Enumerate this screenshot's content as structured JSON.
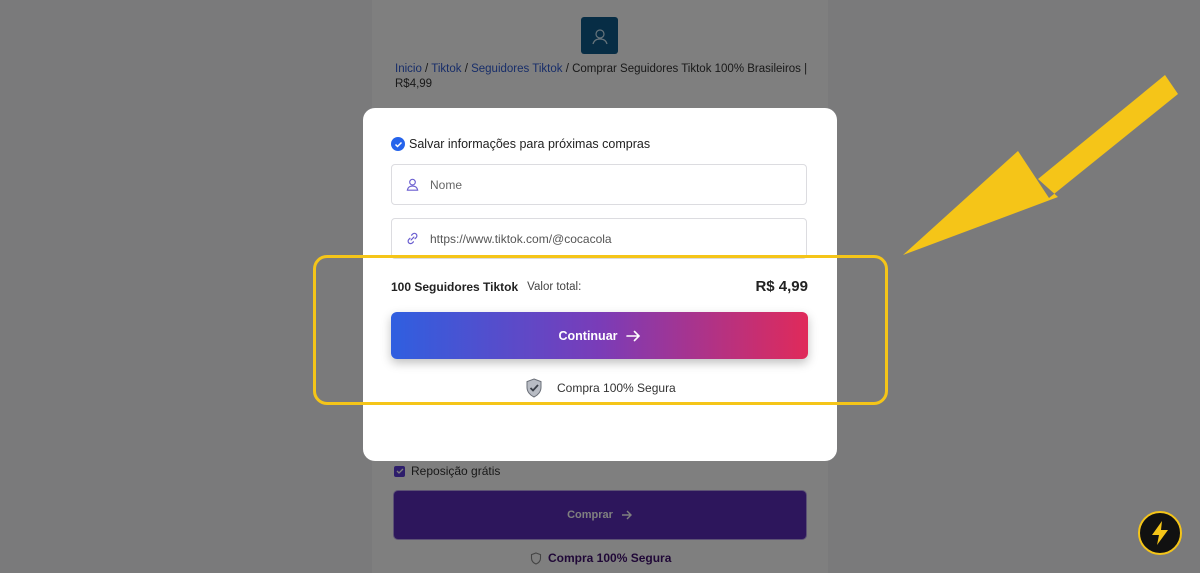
{
  "background": {
    "breadcrumb": {
      "home": "Inicio",
      "sep": " / ",
      "tiktok": "Tiktok",
      "followers": "Seguidores Tiktok",
      "current": "Comprar Seguidores Tiktok 100% Brasileiros | R$4,99"
    },
    "reposicao": "Reposição grátis",
    "buy_label": "Comprar",
    "secure_label": "Compra 100% Segura"
  },
  "modal": {
    "save_label": "Salvar informações para próximas compras",
    "name_placeholder": "Nome",
    "url_value": "https://www.tiktok.com/@cocacola",
    "product": "100 Seguidores Tiktok",
    "total_label": "Valor total:",
    "price": "R$ 4,99",
    "continue_label": "Continuar",
    "secure_label": "Compra 100% Segura"
  },
  "colors": {
    "accent_yellow": "#f5c518",
    "gradient_start": "#2f5fe0",
    "gradient_end": "#e02a5a",
    "buy_purple": "#5a2db8"
  },
  "icons": {
    "user": "user-icon",
    "link": "link-icon",
    "shield": "shield-icon",
    "arrow": "arrow-right-icon",
    "bolt": "lightning-icon"
  }
}
